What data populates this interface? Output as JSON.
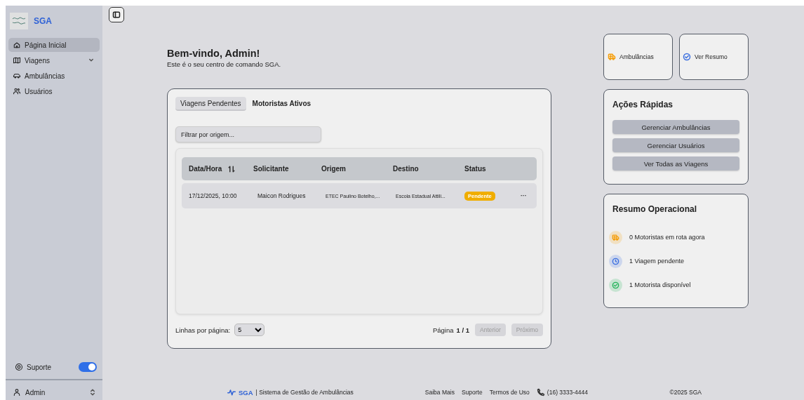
{
  "sidebar": {
    "logo_text": "SGA",
    "items": [
      {
        "label": "Página Inicial",
        "kind": "link",
        "selected": true
      },
      {
        "label": "Viagens",
        "kind": "group",
        "selected": false
      },
      {
        "label": "Ambulâncias",
        "kind": "link",
        "selected": false
      },
      {
        "label": "Usuários",
        "kind": "link",
        "selected": false
      }
    ],
    "support": {
      "label": "Suporte",
      "on": true
    },
    "user": {
      "name": "Admin"
    }
  },
  "welcome": {
    "title": "Bem-vindo, Admin!",
    "subtitle": "Este é o seu centro de comando SGA."
  },
  "trips": {
    "tabs": [
      {
        "label": "Viagens Pendentes",
        "selected": true
      },
      {
        "label": "Motoristas Ativos",
        "selected": false
      }
    ],
    "filter": {
      "placeholder": "Filtrar por origem..."
    },
    "columns": [
      "Data/Hora",
      "Solicitante",
      "Origem",
      "Destino",
      "Status"
    ],
    "rows": [
      {
        "datetime": "17/12/2025, 10:00",
        "requester": "Maicon Rodrigues",
        "origin": "ETEC Paulino Botelho,...",
        "destination": "Escola Estadual Attili...",
        "status": "Pendente",
        "menu": "···"
      }
    ],
    "rows_label": "Linhas por página:",
    "rows_per_page": "5",
    "page_label": "Página",
    "page": "1 / 1",
    "prev": {
      "label": "Anterior",
      "disabled": true
    },
    "next": {
      "label": "Próximo",
      "disabled": true
    }
  },
  "shortcuts": [
    {
      "label": "Ambulâncias",
      "kind": "truck",
      "color": "#f59e0b"
    },
    {
      "label": "Ver Resumo",
      "kind": "check",
      "color": "#3b6fe0"
    }
  ],
  "quick_actions": {
    "title": "Ações Rápidas",
    "buttons": [
      "Gerenciar Ambulâncias",
      "Gerenciar Usuários",
      "Ver Todas as Viagens"
    ]
  },
  "summary": {
    "title": "Resumo Operacional",
    "items": [
      {
        "text": "0 Motoristas em rota agora",
        "kind": "truck",
        "color": "#f59e0b"
      },
      {
        "text": "1 Viagem pendente",
        "kind": "clock",
        "color": "#3b6fe0"
      },
      {
        "text": "1 Motorista disponível",
        "kind": "check",
        "color": "#22b35a"
      }
    ]
  },
  "footer": {
    "brand": "SGA",
    "tagline": "| Sistema de Gestão de Ambulâncias",
    "links": [
      "Saiba Mais",
      "Suporte",
      "Termos de Uso"
    ],
    "phone": "(16) 3333-4444",
    "copyright": "©2025 SGA"
  }
}
